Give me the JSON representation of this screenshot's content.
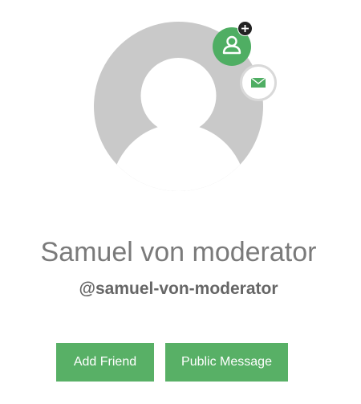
{
  "profile": {
    "display_name": "Samuel von moderator",
    "username": "@samuel-von-moderator"
  },
  "actions": {
    "add_friend_label": "Add Friend",
    "public_message_label": "Public Message"
  },
  "icons": {
    "avatar": "default-avatar-silhouette",
    "add_friend_badge": "user-plus-icon",
    "message_badge": "envelope-icon"
  },
  "colors": {
    "accent_green": "#4fae63",
    "button_green": "#58b066",
    "avatar_gray": "#c9c9c9",
    "name_gray": "#7a7a7a"
  }
}
